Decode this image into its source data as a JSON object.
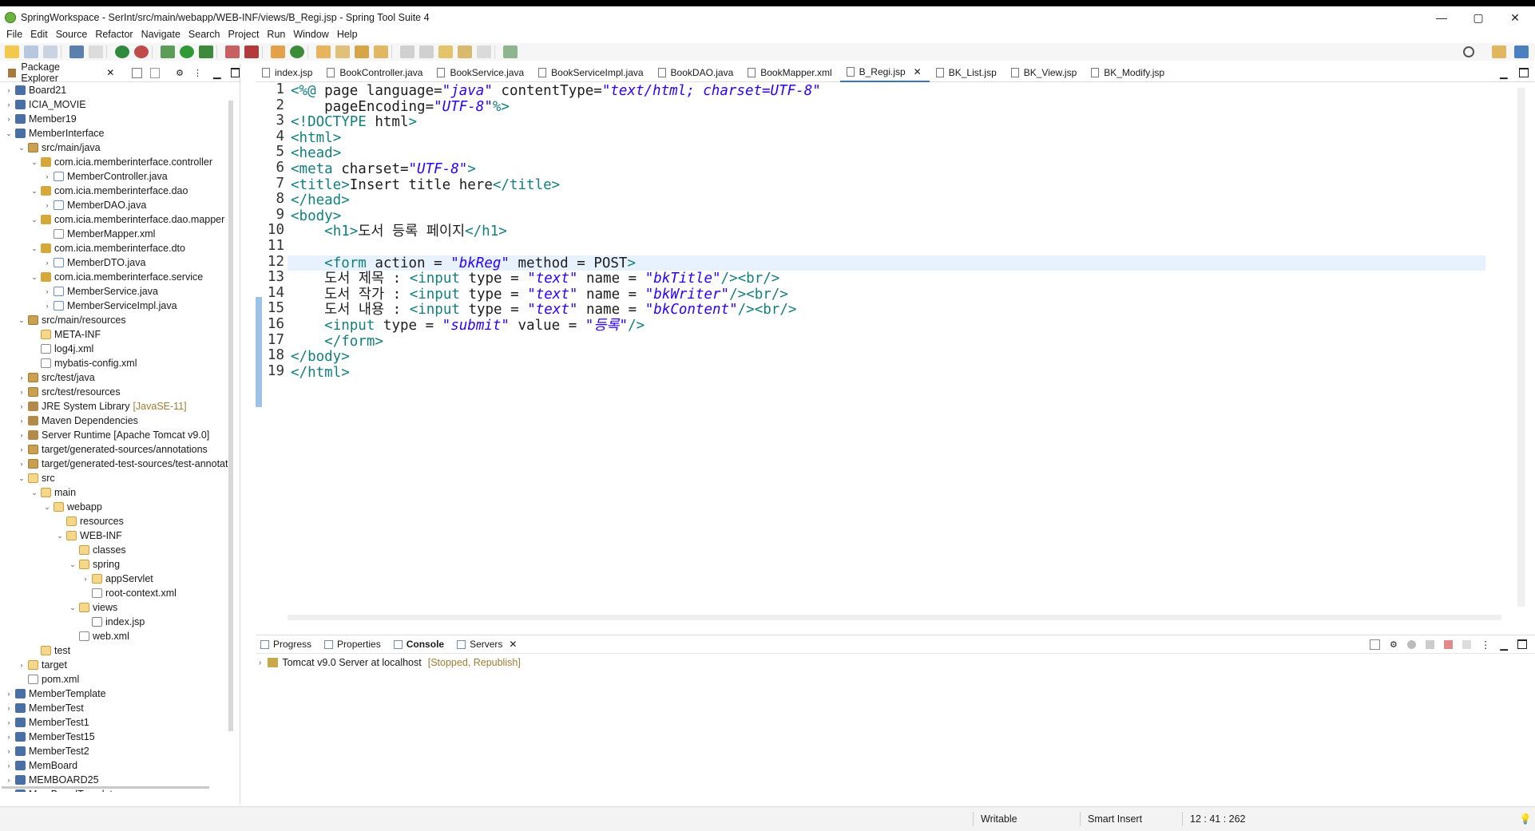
{
  "window": {
    "title": "SpringWorkspace - SerInt/src/main/webapp/WEB-INF/views/B_Regi.jsp - Spring Tool Suite 4",
    "controls": {
      "minimize": "—",
      "maximize": "▢",
      "close": "✕"
    }
  },
  "menu": [
    "File",
    "Edit",
    "Source",
    "Refactor",
    "Navigate",
    "Search",
    "Project",
    "Run",
    "Window",
    "Help"
  ],
  "explorer": {
    "tab_label": "Package Explorer",
    "items": [
      {
        "label": "Board21",
        "depth": 0,
        "twisty": "›",
        "icon": "proj"
      },
      {
        "label": "ICIA_MOVIE",
        "depth": 0,
        "twisty": "›",
        "icon": "proj"
      },
      {
        "label": "Member19",
        "depth": 0,
        "twisty": "›",
        "icon": "proj"
      },
      {
        "label": "MemberInterface",
        "depth": 0,
        "twisty": "⌄",
        "icon": "proj"
      },
      {
        "label": "src/main/java",
        "depth": 1,
        "twisty": "⌄",
        "icon": "src"
      },
      {
        "label": "com.icia.memberinterface.controller",
        "depth": 2,
        "twisty": "⌄",
        "icon": "pkg"
      },
      {
        "label": "MemberController.java",
        "depth": 3,
        "twisty": "›",
        "icon": "java"
      },
      {
        "label": "com.icia.memberinterface.dao",
        "depth": 2,
        "twisty": "⌄",
        "icon": "pkg"
      },
      {
        "label": "MemberDAO.java",
        "depth": 3,
        "twisty": "›",
        "icon": "java"
      },
      {
        "label": "com.icia.memberinterface.dao.mapper",
        "depth": 2,
        "twisty": "⌄",
        "icon": "pkg"
      },
      {
        "label": "MemberMapper.xml",
        "depth": 3,
        "twisty": "",
        "icon": "xml"
      },
      {
        "label": "com.icia.memberinterface.dto",
        "depth": 2,
        "twisty": "⌄",
        "icon": "pkg"
      },
      {
        "label": "MemberDTO.java",
        "depth": 3,
        "twisty": "›",
        "icon": "java"
      },
      {
        "label": "com.icia.memberinterface.service",
        "depth": 2,
        "twisty": "⌄",
        "icon": "pkg"
      },
      {
        "label": "MemberService.java",
        "depth": 3,
        "twisty": "›",
        "icon": "java"
      },
      {
        "label": "MemberServiceImpl.java",
        "depth": 3,
        "twisty": "›",
        "icon": "java"
      },
      {
        "label": "src/main/resources",
        "depth": 1,
        "twisty": "⌄",
        "icon": "src"
      },
      {
        "label": "META-INF",
        "depth": 2,
        "twisty": "",
        "icon": "folder"
      },
      {
        "label": "log4j.xml",
        "depth": 2,
        "twisty": "",
        "icon": "xml"
      },
      {
        "label": "mybatis-config.xml",
        "depth": 2,
        "twisty": "",
        "icon": "xml"
      },
      {
        "label": "src/test/java",
        "depth": 1,
        "twisty": "›",
        "icon": "src"
      },
      {
        "label": "src/test/resources",
        "depth": 1,
        "twisty": "›",
        "icon": "src"
      },
      {
        "label": "JRE System Library",
        "depth": 1,
        "twisty": "›",
        "icon": "lib",
        "suffix": "[JavaSE-11]"
      },
      {
        "label": "Maven Dependencies",
        "depth": 1,
        "twisty": "›",
        "icon": "lib"
      },
      {
        "label": "Server Runtime [Apache Tomcat v9.0]",
        "depth": 1,
        "twisty": "›",
        "icon": "lib"
      },
      {
        "label": "target/generated-sources/annotations",
        "depth": 1,
        "twisty": "›",
        "icon": "src"
      },
      {
        "label": "target/generated-test-sources/test-annotatic",
        "depth": 1,
        "twisty": "›",
        "icon": "src"
      },
      {
        "label": "src",
        "depth": 1,
        "twisty": "⌄",
        "icon": "folder"
      },
      {
        "label": "main",
        "depth": 2,
        "twisty": "⌄",
        "icon": "folder"
      },
      {
        "label": "webapp",
        "depth": 3,
        "twisty": "⌄",
        "icon": "folder"
      },
      {
        "label": "resources",
        "depth": 4,
        "twisty": "",
        "icon": "folder"
      },
      {
        "label": "WEB-INF",
        "depth": 4,
        "twisty": "⌄",
        "icon": "folder"
      },
      {
        "label": "classes",
        "depth": 5,
        "twisty": "",
        "icon": "folder"
      },
      {
        "label": "spring",
        "depth": 5,
        "twisty": "⌄",
        "icon": "folder"
      },
      {
        "label": "appServlet",
        "depth": 6,
        "twisty": "›",
        "icon": "folder"
      },
      {
        "label": "root-context.xml",
        "depth": 6,
        "twisty": "",
        "icon": "xml"
      },
      {
        "label": "views",
        "depth": 5,
        "twisty": "⌄",
        "icon": "folder"
      },
      {
        "label": "index.jsp",
        "depth": 6,
        "twisty": "",
        "icon": "jsp"
      },
      {
        "label": "web.xml",
        "depth": 5,
        "twisty": "",
        "icon": "xml"
      },
      {
        "label": "test",
        "depth": 2,
        "twisty": "",
        "icon": "folder"
      },
      {
        "label": "target",
        "depth": 1,
        "twisty": "›",
        "icon": "folder"
      },
      {
        "label": "pom.xml",
        "depth": 1,
        "twisty": "",
        "icon": "xml"
      },
      {
        "label": "MemberTemplate",
        "depth": 0,
        "twisty": "›",
        "icon": "proj"
      },
      {
        "label": "MemberTest",
        "depth": 0,
        "twisty": "›",
        "icon": "proj"
      },
      {
        "label": "MemberTest1",
        "depth": 0,
        "twisty": "›",
        "icon": "proj"
      },
      {
        "label": "MemberTest15",
        "depth": 0,
        "twisty": "›",
        "icon": "proj"
      },
      {
        "label": "MemberTest2",
        "depth": 0,
        "twisty": "›",
        "icon": "proj"
      },
      {
        "label": "MemBoard",
        "depth": 0,
        "twisty": "›",
        "icon": "proj"
      },
      {
        "label": "MEMBOARD25",
        "depth": 0,
        "twisty": "›",
        "icon": "proj"
      },
      {
        "label": "MemBoardTemplate",
        "depth": 0,
        "twisty": "›",
        "icon": "proj"
      }
    ]
  },
  "editor": {
    "tabs": [
      {
        "label": "index.jsp",
        "active": false
      },
      {
        "label": "BookController.java",
        "active": false
      },
      {
        "label": "BookService.java",
        "active": false
      },
      {
        "label": "BookServiceImpl.java",
        "active": false
      },
      {
        "label": "BookDAO.java",
        "active": false
      },
      {
        "label": "BookMapper.xml",
        "active": false
      },
      {
        "label": "B_Regi.jsp",
        "active": true
      },
      {
        "label": "BK_List.jsp",
        "active": false
      },
      {
        "label": "BK_View.jsp",
        "active": false
      },
      {
        "label": "BK_Modify.jsp",
        "active": false
      }
    ],
    "lines": [
      "<%@ page language=\"java\" contentType=\"text/html; charset=UTF-8\"",
      "    pageEncoding=\"UTF-8\"%>",
      "<!DOCTYPE html>",
      "<html>",
      "<head>",
      "<meta charset=\"UTF-8\">",
      "<title>Insert title here</title>",
      "</head>",
      "<body>",
      "    <h1>도서 등록 페이지</h1>",
      "",
      "    <form action = \"bkReg\" method = POST>",
      "    도서 제목 : <input type = \"text\" name = \"bkTitle\"/><br/>",
      "    도서 작가 : <input type = \"text\" name = \"bkWriter\"/><br/>",
      "    도서 내용 : <input type = \"text\" name = \"bkContent\"/><br/>",
      "    <input type = \"submit\" value = \"등록\"/>",
      "    </form>",
      "</body>",
      "</html>"
    ],
    "highlighted_line": 12
  },
  "console": {
    "tabs": [
      {
        "label": "Progress",
        "active": false
      },
      {
        "label": "Properties",
        "active": false
      },
      {
        "label": "Console",
        "active": true
      },
      {
        "label": "Servers",
        "active": false
      }
    ],
    "server": {
      "label": "Tomcat v9.0 Server at localhost",
      "state": "[Stopped, Republish]"
    }
  },
  "status": {
    "writable": "Writable",
    "insert_mode": "Smart Insert",
    "position": "12 : 41 : 262"
  }
}
